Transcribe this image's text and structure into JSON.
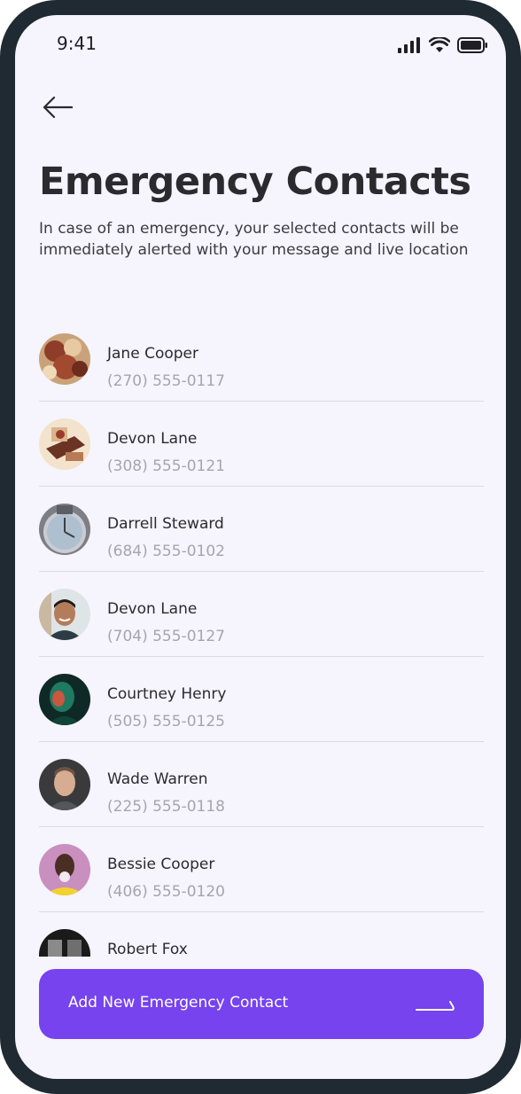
{
  "status_bar": {
    "time": "9:41",
    "icons": [
      "cellular-signal-icon",
      "wifi-icon",
      "battery-icon"
    ]
  },
  "header": {
    "back_icon": "arrow-left-icon",
    "title": "Emergency Contacts",
    "subtitle": "In case of an emergency, your selected contacts will be immediately alerted with your message and live location"
  },
  "contacts": [
    {
      "name": "Jane Cooper",
      "phone": "(270) 555-0117",
      "avatar": "food-photo"
    },
    {
      "name": "Devon Lane",
      "phone": "(308) 555-0121",
      "avatar": "object-photo"
    },
    {
      "name": "Darrell Steward",
      "phone": "(684) 555-0102",
      "avatar": "clock-photo"
    },
    {
      "name": "Devon Lane",
      "phone": "(704) 555-0127",
      "avatar": "man-smiling-photo"
    },
    {
      "name": "Courtney Henry",
      "phone": "(505) 555-0125",
      "avatar": "woman-neon-light-photo"
    },
    {
      "name": "Wade Warren",
      "phone": "(225) 555-0118",
      "avatar": "man-portrait-photo"
    },
    {
      "name": "Bessie Cooper",
      "phone": "(406) 555-0120",
      "avatar": "woman-pink-background-photo"
    },
    {
      "name": "Robert Fox",
      "phone": "",
      "avatar": "window-photo"
    }
  ],
  "add_button": {
    "label": "Add New Emergency Contact",
    "icon": "arrow-right-icon"
  },
  "colors": {
    "accent": "#7643ef",
    "background": "#f6f4fc",
    "frame": "#1f2a33",
    "text_primary": "#2b2b2f",
    "text_secondary": "#a6a5ad"
  }
}
